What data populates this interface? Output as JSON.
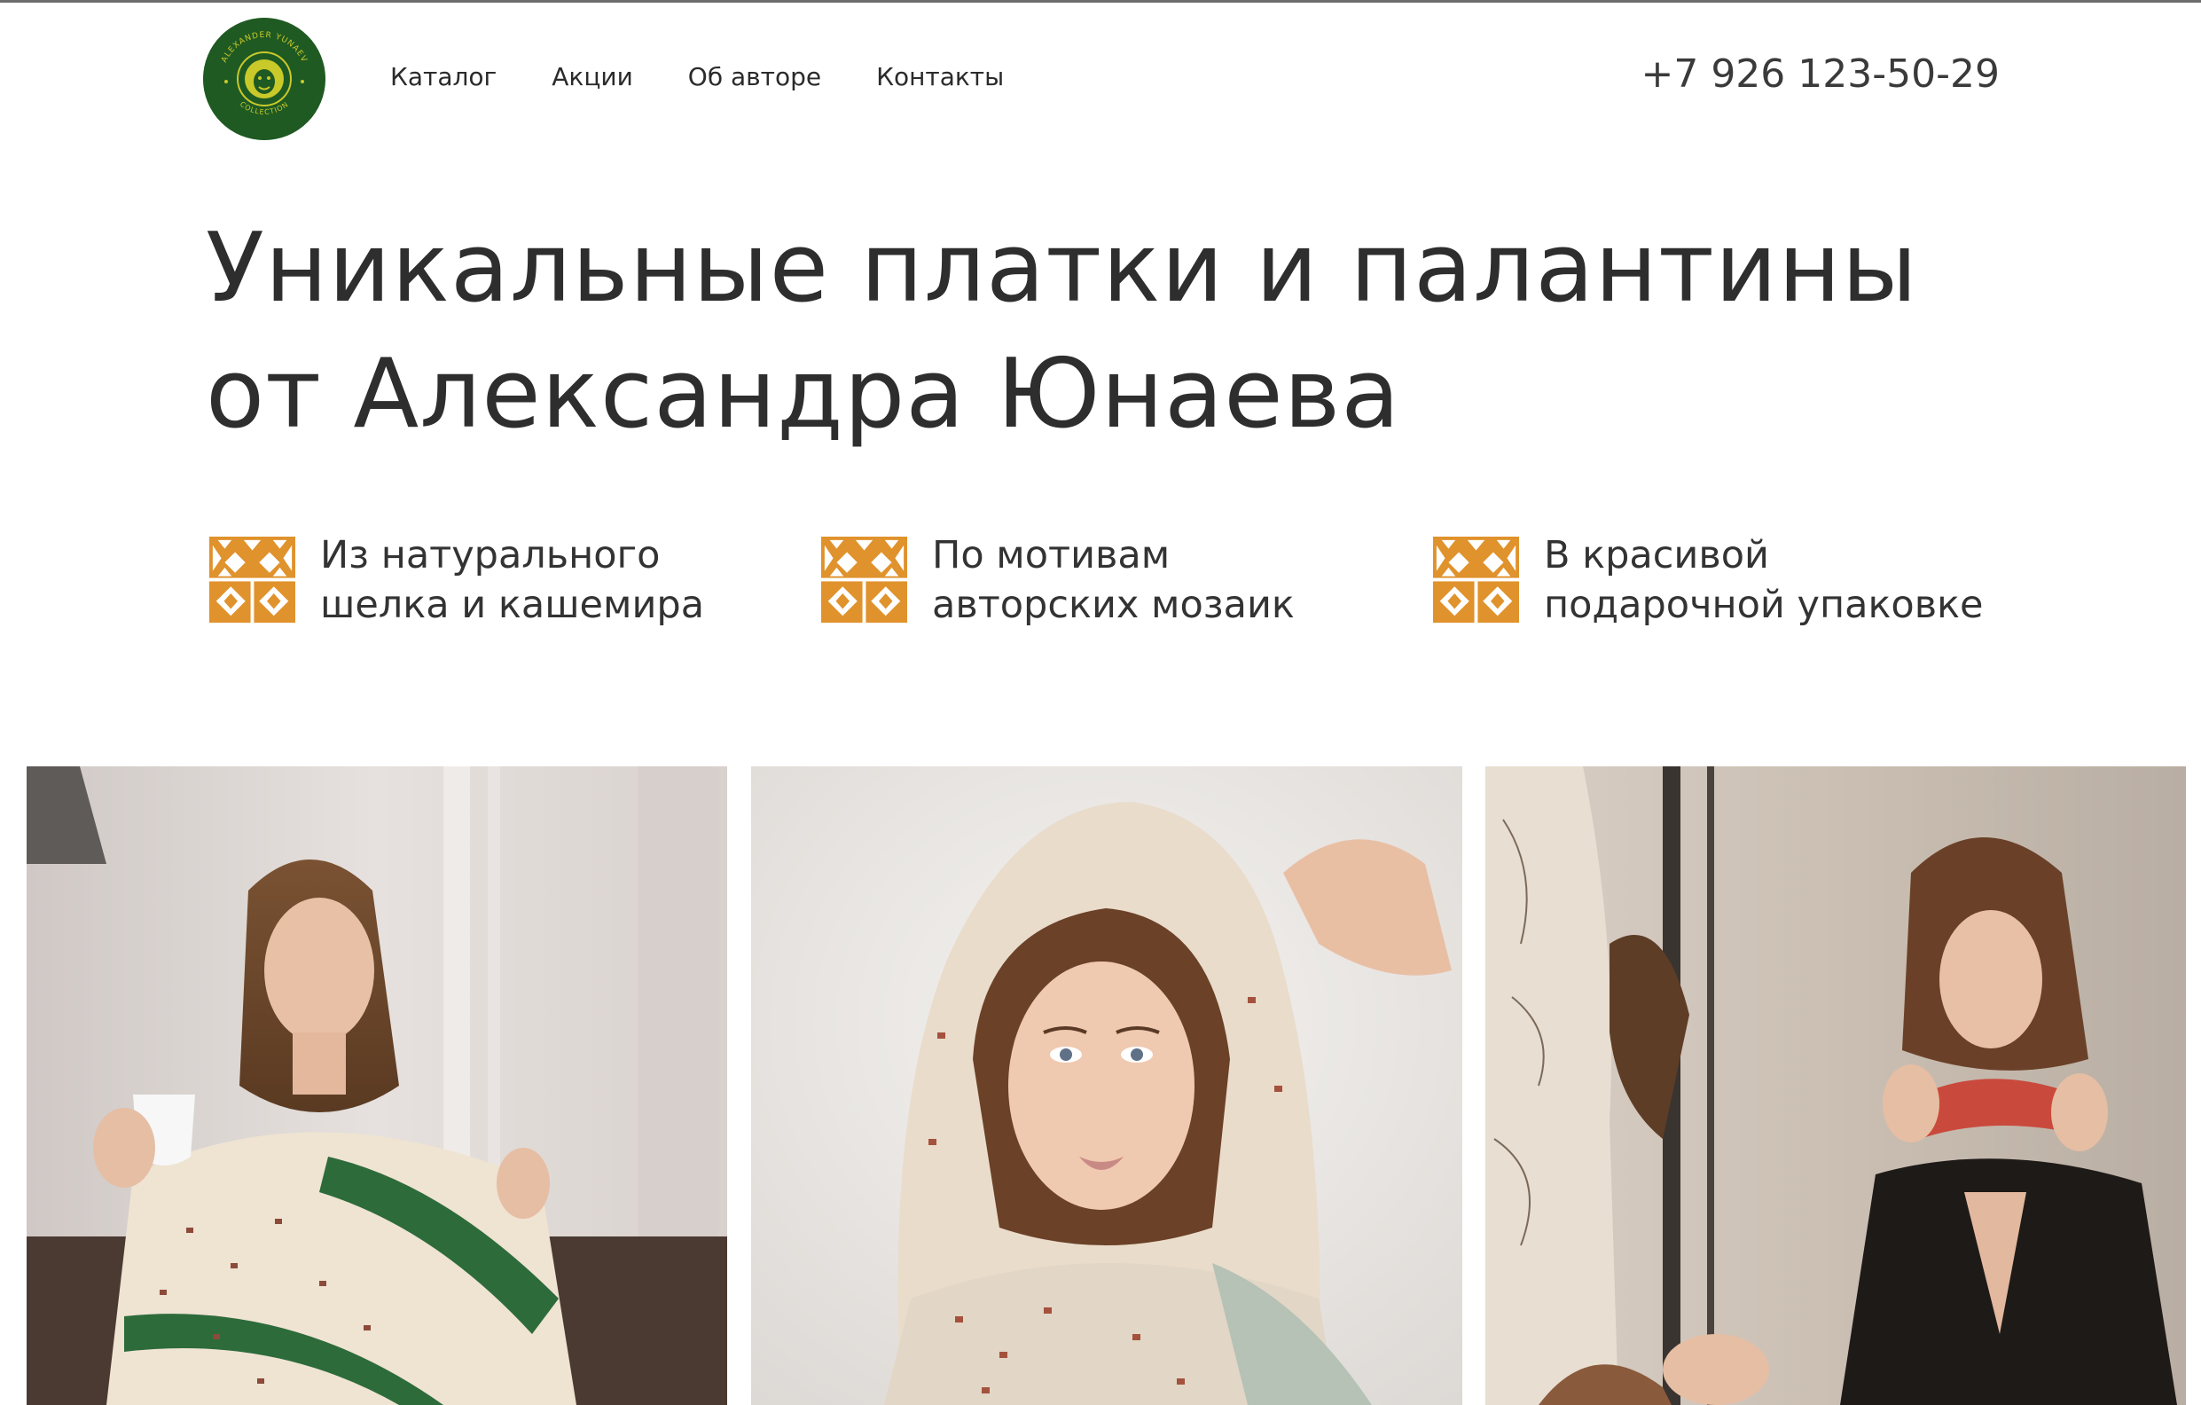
{
  "header": {
    "logo": {
      "ring_text": "ALEXANDER YUNAEV",
      "sub_text": "COLLECTION",
      "color": "#1f5a23",
      "accent": "#c9c92a"
    },
    "nav": [
      {
        "label": "Каталог"
      },
      {
        "label": "Акции"
      },
      {
        "label": "Об авторе"
      },
      {
        "label": "Контакты"
      }
    ],
    "phone": "+7 926 123-50-29"
  },
  "hero": {
    "title_line1": "Уникальные платки и палантины",
    "title_line2": "от Александра Юнаева"
  },
  "features": [
    {
      "icon": "mosaic-icon",
      "line1": "Из натурального",
      "line2": "шелка и кашемира"
    },
    {
      "icon": "mosaic-icon",
      "line1": "По мотивам",
      "line2": "авторских мозаик"
    },
    {
      "icon": "mosaic-icon",
      "line1": "В красивой",
      "line2": "подарочной упаковке"
    }
  ],
  "colors": {
    "accent_orange": "#e0922c",
    "text": "#2e2e2e",
    "brand_green": "#1f5a23"
  },
  "gallery": [
    {
      "subject": "model-with-cup-and-scarf"
    },
    {
      "subject": "model-with-headscarf"
    },
    {
      "subject": "model-at-mirror"
    }
  ]
}
